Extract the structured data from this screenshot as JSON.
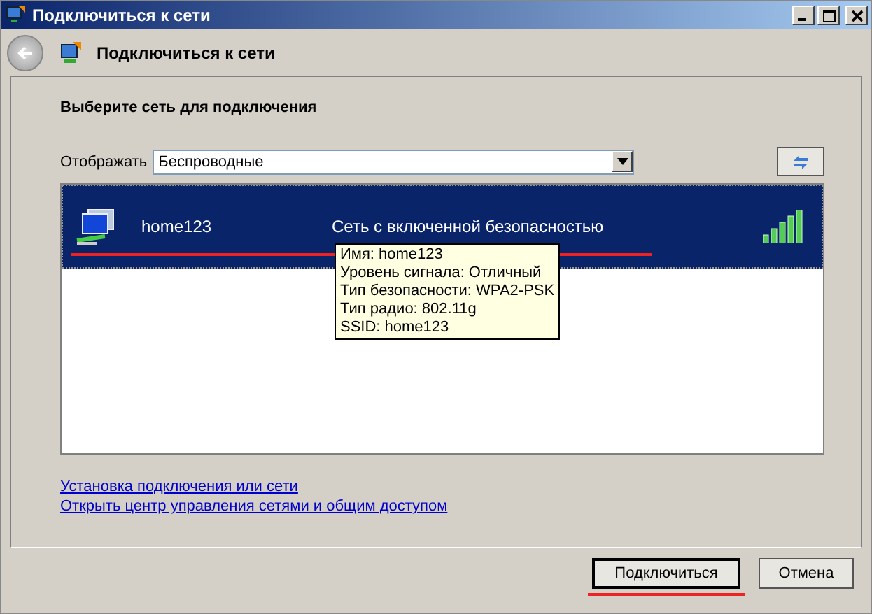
{
  "window": {
    "title": "Подключиться к сети"
  },
  "nav": {
    "title": "Подключиться к сети"
  },
  "heading": "Выберите сеть для подключения",
  "filter": {
    "label": "Отображать",
    "value": "Беспроводные"
  },
  "networks": [
    {
      "name": "home123",
      "status": "Сеть с включенной безопасностью",
      "selected": true
    }
  ],
  "tooltip": [
    "Имя: home123",
    "Уровень сигнала: Отличный",
    "Тип безопасности: WPA2-PSK",
    "Тип радио: 802.11g",
    "SSID: home123"
  ],
  "links": [
    "Установка подключения или сети",
    "Открыть центр управления сетями и общим доступом"
  ],
  "buttons": [
    {
      "label": "Подключиться",
      "kind": "default"
    },
    {
      "label": "Отмена",
      "kind": "normal"
    }
  ]
}
